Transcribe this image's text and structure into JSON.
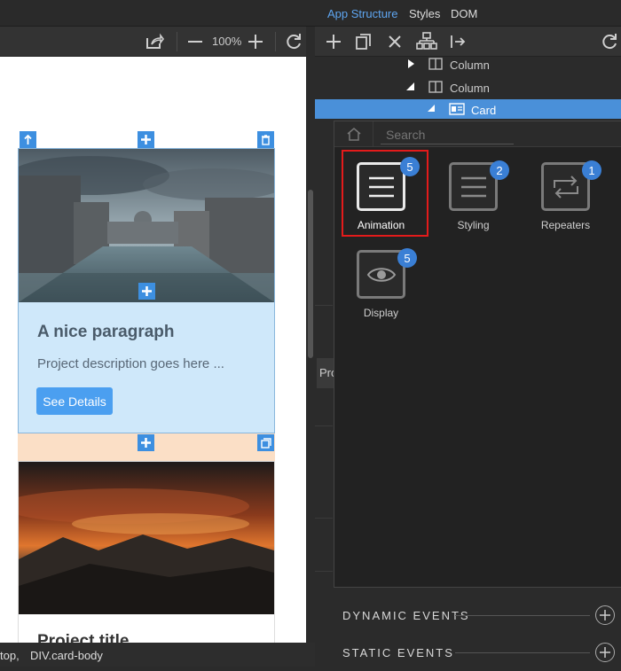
{
  "left_toolbar": {
    "zoom": "100%"
  },
  "status_bar": {
    "crumb_1": "top,",
    "crumb_2": "DIV.card-body"
  },
  "canvas": {
    "card1_title": "A nice paragraph",
    "card1_text": "Project description goes here ...",
    "card1_button": "See Details",
    "card2_title": "Project title"
  },
  "right_tabs": {
    "app_structure": "App Structure",
    "styles": "Styles",
    "dom": "DOM"
  },
  "tree": {
    "rows": [
      {
        "label": "Column"
      },
      {
        "label": "Column"
      },
      {
        "label": "Card"
      }
    ]
  },
  "side_tab": {
    "label": "Pro"
  },
  "popup": {
    "search_placeholder": "Search",
    "tiles": [
      {
        "label": "Animation",
        "badge": "5",
        "icon": "hamburger-icon"
      },
      {
        "label": "Styling",
        "badge": "2",
        "icon": "hamburger-icon"
      },
      {
        "label": "Repeaters",
        "badge": "1",
        "icon": "repeat-icon"
      },
      {
        "label": "Display",
        "badge": "5",
        "icon": "eye-icon"
      }
    ]
  },
  "events": {
    "dynamic": "DYNAMIC EVENTS",
    "static": "STATIC EVENTS"
  }
}
